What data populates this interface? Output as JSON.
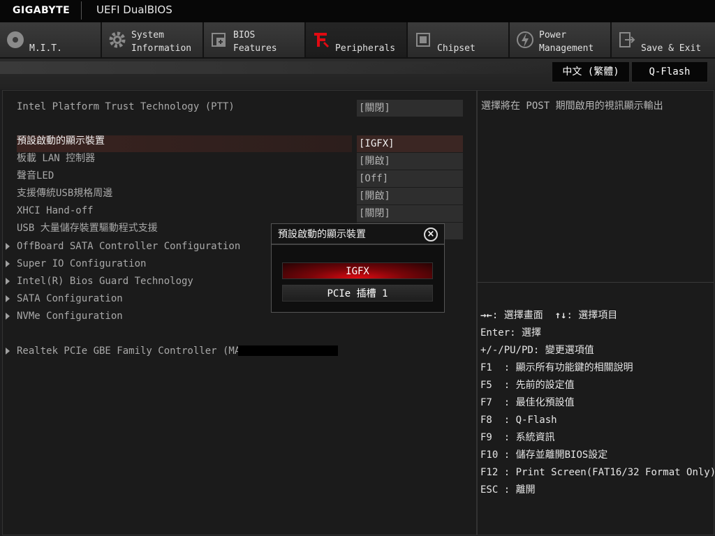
{
  "header": {
    "brand": "GIGABYTE",
    "product": "UEFI DualBIOS"
  },
  "tabs": [
    {
      "label": "M.I.T.",
      "icon": "disc-icon"
    },
    {
      "label": "System\nInformation",
      "icon": "gear-icon"
    },
    {
      "label": "BIOS\nFeatures",
      "icon": "bios-chip-icon"
    },
    {
      "label": "Peripherals",
      "icon": "peripherals-icon",
      "active": true
    },
    {
      "label": "Chipset",
      "icon": "chipset-icon"
    },
    {
      "label": "Power\nManagement",
      "icon": "power-icon"
    },
    {
      "label": "Save & Exit",
      "icon": "exit-icon"
    }
  ],
  "subbar": {
    "language_button": "中文 (繁體)",
    "qflash_button": "Q-Flash"
  },
  "settings": [
    {
      "label": "Intel Platform Trust Technology (PTT)",
      "value": "[關閉]"
    },
    {
      "label": "預設啟動的顯示裝置",
      "value": "[IGFX]"
    },
    {
      "label": "板載 LAN 控制器",
      "value": "[開啟]"
    },
    {
      "label": "聲音LED",
      "value": "[Off]"
    },
    {
      "label": "支援傳統USB規格周邊",
      "value": "[開啟]"
    },
    {
      "label": "XHCI Hand-off",
      "value": "[關閉]"
    },
    {
      "label": "USB 大量儲存裝置驅動程式支援",
      "value": ""
    }
  ],
  "submenus": [
    "OffBoard SATA Controller Configuration",
    "Super IO Configuration",
    "Intel(R) Bios Guard Technology",
    "SATA Configuration",
    "NVMe Configuration",
    "Realtek PCIe GBE Family Controller (MAC:"
  ],
  "help": {
    "description": "選擇將在 POST 期間啟用的視訊顯示輸出",
    "keys": [
      {
        "key": "→←",
        "text": ": 選擇畫面",
        "key2": "↑↓",
        "text2": ": 選擇項目"
      },
      {
        "key": "Enter",
        "text": ": 選擇"
      },
      {
        "key": "+/-/PU/PD",
        "text": ": 變更選項值"
      },
      {
        "key": "F1 ",
        "text": " : 顯示所有功能鍵的相關說明"
      },
      {
        "key": "F5 ",
        "text": " : 先前的設定值"
      },
      {
        "key": "F7 ",
        "text": " : 最佳化預設值"
      },
      {
        "key": "F8 ",
        "text": " : Q-Flash"
      },
      {
        "key": "F9 ",
        "text": " : 系統資訊"
      },
      {
        "key": "F10",
        "text": " : 儲存並離開BIOS設定"
      },
      {
        "key": "F12",
        "text": " : Print Screen(FAT16/32 Format Only)"
      },
      {
        "key": "ESC",
        "text": " : 離開"
      }
    ]
  },
  "popup": {
    "title": "預設啟動的顯示裝置",
    "options": [
      "IGFX",
      "PCIe 插槽 1"
    ],
    "selected": "IGFX"
  },
  "colors": {
    "accent": "#e10a12",
    "background": "#1d1d1e",
    "panel": "#1b1b1b"
  }
}
